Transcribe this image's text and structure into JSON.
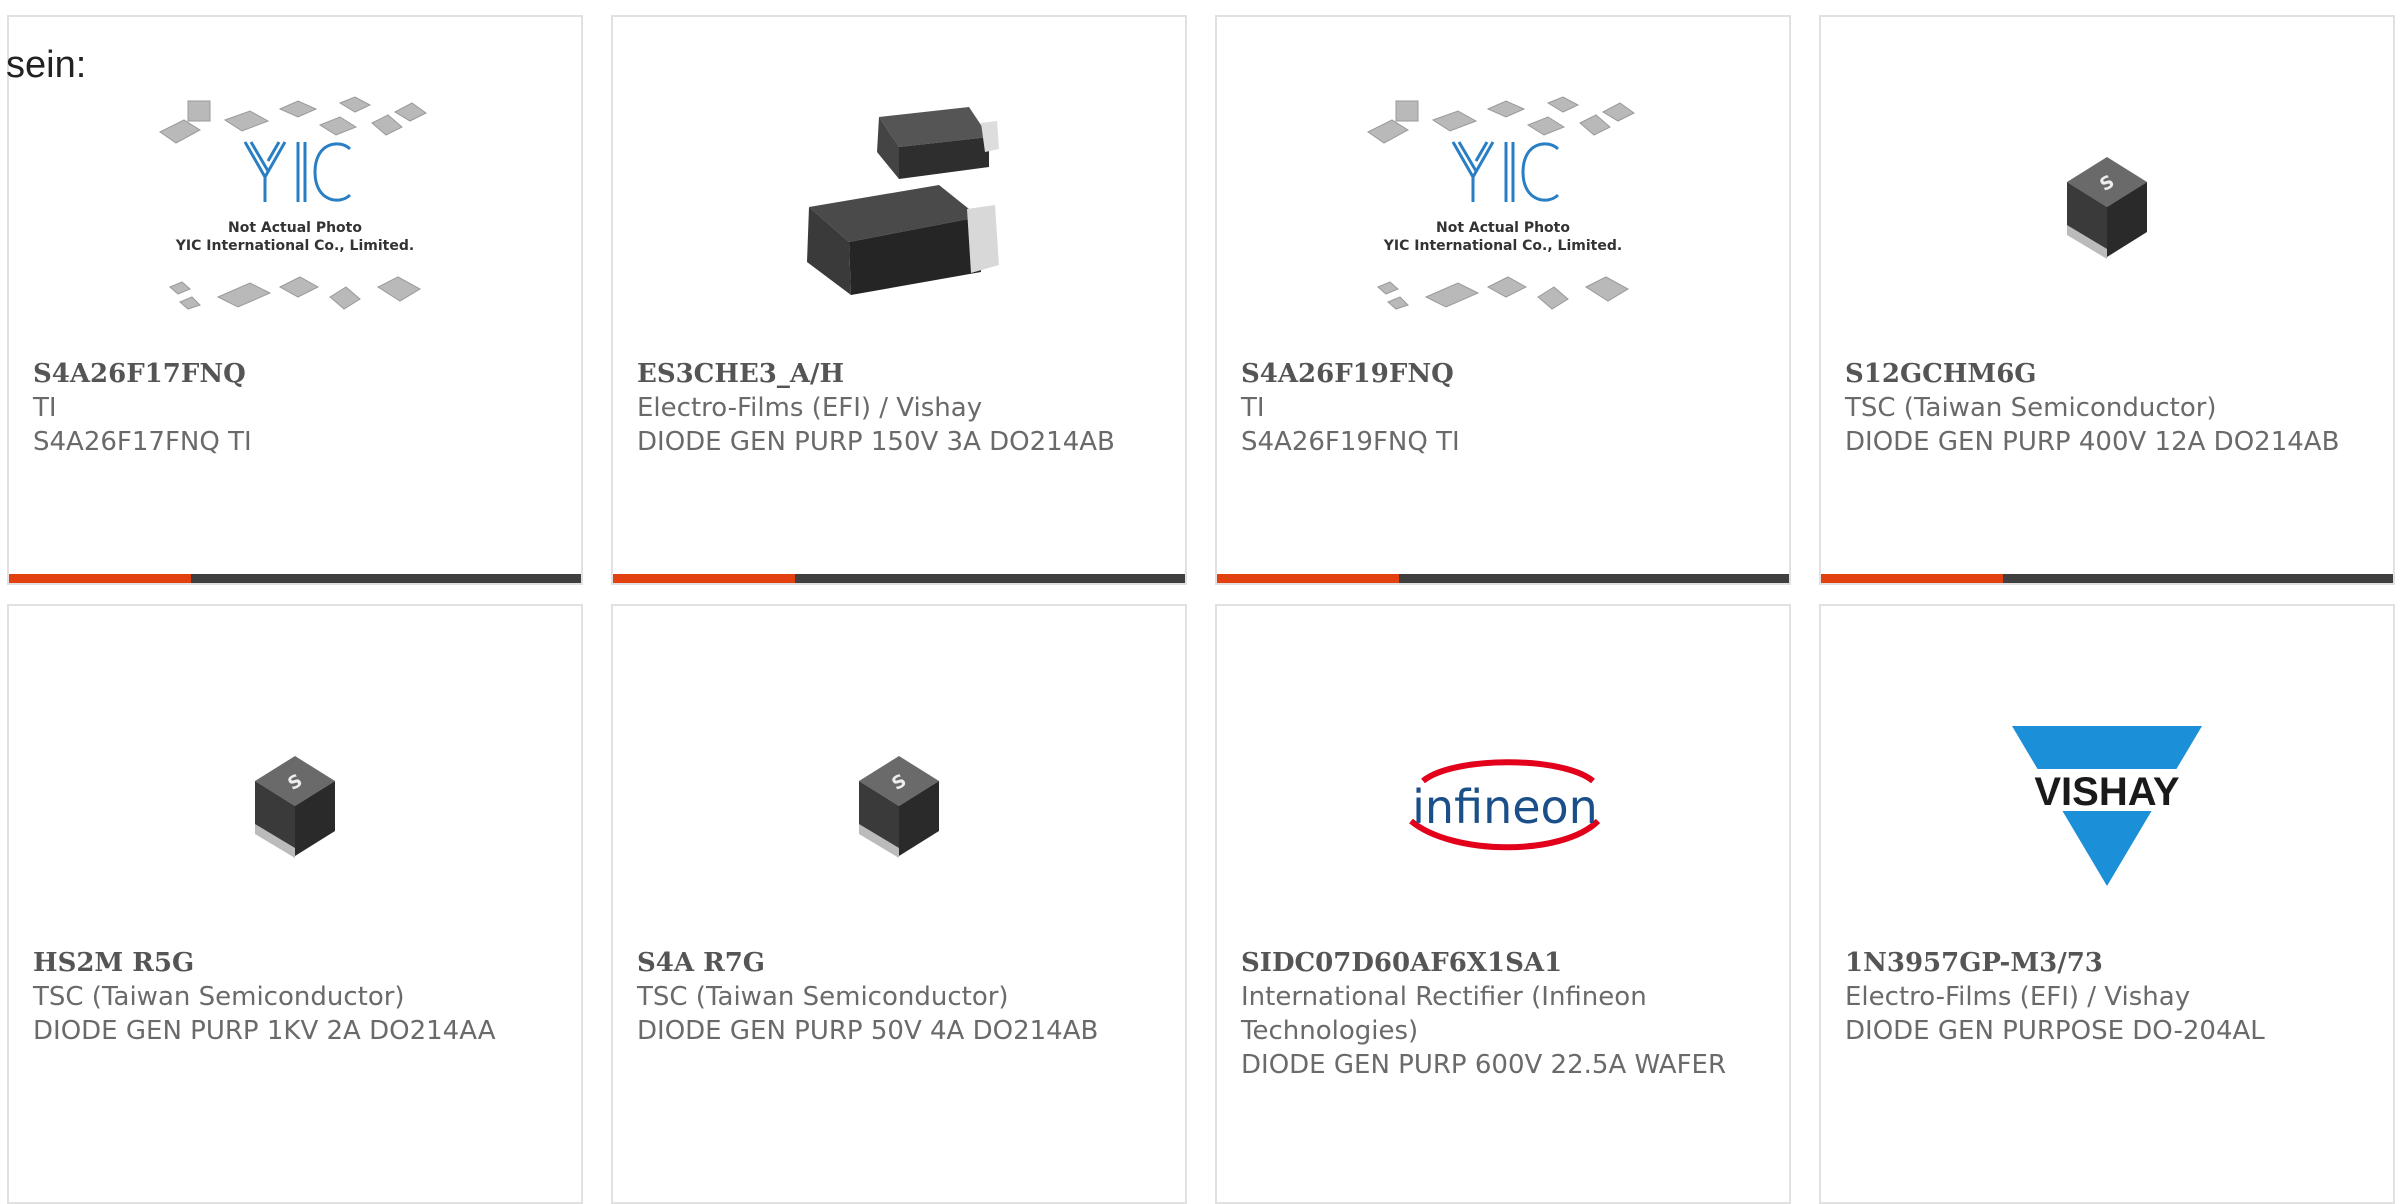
{
  "intro_text": "sein:",
  "placeholder_photo": {
    "brand": "YIC",
    "line1": "Not Actual Photo",
    "line2": "YIC International Co., Limited."
  },
  "products": [
    {
      "part": "S4A26F17FNQ",
      "maker": "TI",
      "desc": "S4A26F17FNQ TI",
      "image": "placeholder-photo"
    },
    {
      "part": "ES3CHE3_A/H",
      "maker": "Electro-Films (EFI) / Vishay",
      "desc": "DIODE GEN PURP 150V 3A DO214AB",
      "image": "diode-package-photo"
    },
    {
      "part": "S4A26F19FNQ",
      "maker": "TI",
      "desc": "S4A26F19FNQ TI",
      "image": "placeholder-photo"
    },
    {
      "part": "S12GCHM6G",
      "maker": "TSC (Taiwan Semiconductor)",
      "desc": "DIODE GEN PURP 400V 12A DO214AB",
      "image": "tsc-chip-photo"
    },
    {
      "part": "HS2M R5G",
      "maker": "TSC (Taiwan Semiconductor)",
      "desc": "DIODE GEN PURP 1KV 2A DO214AA",
      "image": "tsc-chip-photo"
    },
    {
      "part": "S4A R7G",
      "maker": "TSC (Taiwan Semiconductor)",
      "desc": "DIODE GEN PURP 50V 4A DO214AB",
      "image": "tsc-chip-photo"
    },
    {
      "part": "SIDC07D60AF6X1SA1",
      "maker": "International Rectifier (Infineon Technologies)",
      "desc": "DIODE GEN PURP 600V 22.5A WAFER",
      "image": "infineon-logo",
      "logo_text": "infineon"
    },
    {
      "part": "1N3957GP-M3/73",
      "maker": "Electro-Films (EFI) / Vishay",
      "desc": "DIODE GEN PURPOSE DO-204AL",
      "image": "vishay-logo",
      "logo_text": "VISHAY"
    }
  ],
  "colors": {
    "accent": "#e3400f",
    "bar": "#3f3f3f",
    "border": "#e1e1e1"
  }
}
